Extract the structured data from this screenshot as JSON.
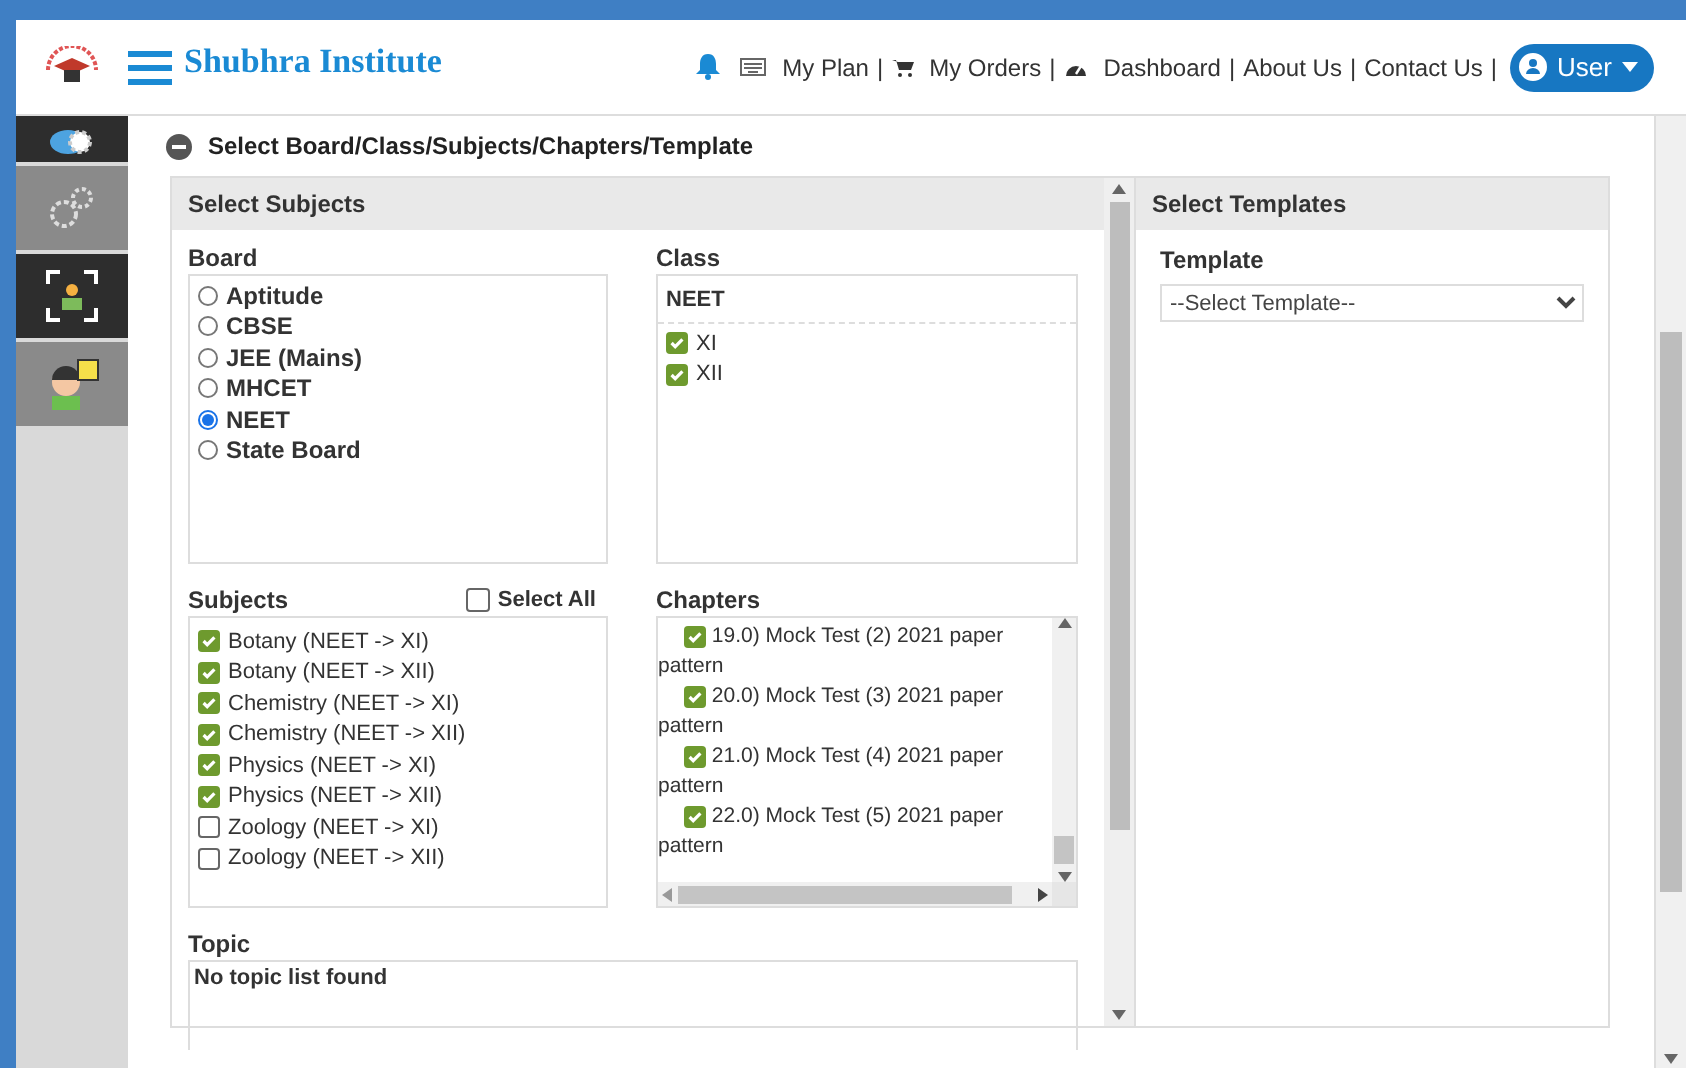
{
  "header": {
    "brand": "Shubhra Institute",
    "nav": [
      {
        "label": "My Plan",
        "separator": "|"
      },
      {
        "label": "My Orders",
        "separator": "|"
      },
      {
        "label": "Dashboard",
        "separator": "|"
      },
      {
        "label": "About Us",
        "separator": "|"
      },
      {
        "label": "Contact Us",
        "separator": "|"
      }
    ],
    "user": "User"
  },
  "sidebar": {
    "items": [
      {
        "selected": true
      },
      {
        "selected": false
      },
      {
        "selected": true
      },
      {
        "selected": false
      }
    ]
  },
  "section": {
    "title": "Select Board/Class/Subjects/Chapters/Template"
  },
  "subjects_panel": {
    "title": "Select Subjects",
    "board": {
      "label": "Board",
      "options": [
        {
          "label": "Aptitude",
          "selected": false
        },
        {
          "label": "CBSE",
          "selected": false
        },
        {
          "label": "JEE (Mains)",
          "selected": false
        },
        {
          "label": "MHCET",
          "selected": false
        },
        {
          "label": "NEET",
          "selected": true
        },
        {
          "label": "State Board",
          "selected": false
        }
      ]
    },
    "class": {
      "label": "Class",
      "group": "NEET",
      "options": [
        {
          "label": "XI",
          "checked": true
        },
        {
          "label": "XII",
          "checked": true
        }
      ]
    },
    "subjects": {
      "label": "Subjects",
      "select_all": {
        "label": "Select All",
        "checked": false
      },
      "options": [
        {
          "label": "Botany (NEET -> XI)",
          "checked": true
        },
        {
          "label": "Botany (NEET -> XII)",
          "checked": true
        },
        {
          "label": "Chemistry (NEET -> XI)",
          "checked": true
        },
        {
          "label": "Chemistry (NEET -> XII)",
          "checked": true
        },
        {
          "label": "Physics (NEET -> XI)",
          "checked": true
        },
        {
          "label": "Physics (NEET -> XII)",
          "checked": true
        },
        {
          "label": "Zoology (NEET -> XI)",
          "checked": false
        },
        {
          "label": "Zoology (NEET -> XII)",
          "checked": false
        }
      ]
    },
    "chapters": {
      "label": "Chapters",
      "options": [
        {
          "label": "19.0) Mock Test (2) 2021 paper pattern",
          "checked": true
        },
        {
          "label": "20.0) Mock Test (3) 2021 paper pattern",
          "checked": true
        },
        {
          "label": "21.0) Mock Test (4) 2021 paper pattern",
          "checked": true
        },
        {
          "label": "22.0) Mock Test (5) 2021 paper pattern",
          "checked": true
        }
      ]
    },
    "topic": {
      "label": "Topic",
      "message": "No topic list found"
    }
  },
  "templates_panel": {
    "title": "Select Templates",
    "template": {
      "label": "Template",
      "placeholder": "--Select Template--"
    }
  }
}
